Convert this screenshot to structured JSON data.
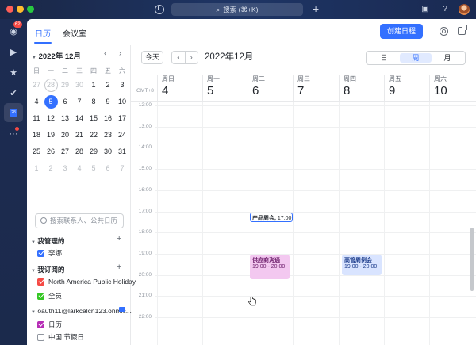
{
  "titlebar": {
    "search_label": "搜索 (⌘+K)",
    "traffic_colors": [
      "#fe5f57",
      "#febc2e",
      "#28c840"
    ]
  },
  "sidebar": {
    "badge": "62",
    "items": [
      "messenger-icon",
      "video-icon",
      "star-icon",
      "check-icon",
      "calendar-icon",
      "more-icon"
    ]
  },
  "tabs": {
    "calendar": "日历",
    "meeting_room": "会议室"
  },
  "toolbar": {
    "create_label": "创建日程"
  },
  "mini_calendar": {
    "title": "2022年 12月",
    "weekdays": [
      "日",
      "一",
      "二",
      "三",
      "四",
      "五",
      "六"
    ],
    "weeks": [
      [
        "27",
        "28",
        "29",
        "30",
        "1",
        "2",
        "3"
      ],
      [
        "4",
        "5",
        "6",
        "7",
        "8",
        "9",
        "10"
      ],
      [
        "11",
        "12",
        "13",
        "14",
        "15",
        "16",
        "17"
      ],
      [
        "18",
        "19",
        "20",
        "21",
        "22",
        "23",
        "24"
      ],
      [
        "25",
        "26",
        "27",
        "28",
        "29",
        "30",
        "31"
      ],
      [
        "1",
        "2",
        "3",
        "4",
        "5",
        "6",
        "7"
      ]
    ]
  },
  "calendar_search": {
    "placeholder": "搜索联系人、公共日历"
  },
  "my_calendars": {
    "title": "我管理的",
    "items": [
      {
        "label": "李娜",
        "color": "#3370ff"
      }
    ]
  },
  "subscribed": {
    "title": "我订阅的",
    "items": [
      {
        "label": "North America Public Holiday",
        "color": "#f54a45"
      },
      {
        "label": "全员",
        "color": "#34c724"
      }
    ]
  },
  "account": {
    "title": "oauth11@larkcalcn123.onmic...",
    "items": [
      {
        "label": "日历",
        "color": "#b62eb6",
        "checked": true
      },
      {
        "label": "中国 节假日",
        "checked": false
      }
    ]
  },
  "main": {
    "today_label": "今天",
    "prev": "‹",
    "next": "›",
    "month_title": "2022年12月",
    "views": [
      "日",
      "周",
      "月"
    ],
    "active_view": "周",
    "gmt": "GMT+8"
  },
  "days": [
    {
      "weekday": "周日",
      "date": "4"
    },
    {
      "weekday": "周一",
      "date": "5"
    },
    {
      "weekday": "周二",
      "date": "6"
    },
    {
      "weekday": "周三",
      "date": "7"
    },
    {
      "weekday": "周四",
      "date": "8"
    },
    {
      "weekday": "周五",
      "date": "9"
    },
    {
      "weekday": "周六",
      "date": "10"
    }
  ],
  "hours": [
    "12:00",
    "13:00",
    "14:00",
    "15:00",
    "16:00",
    "17:00",
    "18:00",
    "19:00",
    "20:00",
    "21:00",
    "22:00"
  ],
  "events": [
    {
      "title": "产品周会,",
      "time": "17:00",
      "day": "周二"
    },
    {
      "title": "供应商沟通",
      "time": "19:00 - 20:00",
      "day": "周二"
    },
    {
      "title": "高管周例会",
      "time": "19:00 - 20:00",
      "day": "周四"
    }
  ]
}
